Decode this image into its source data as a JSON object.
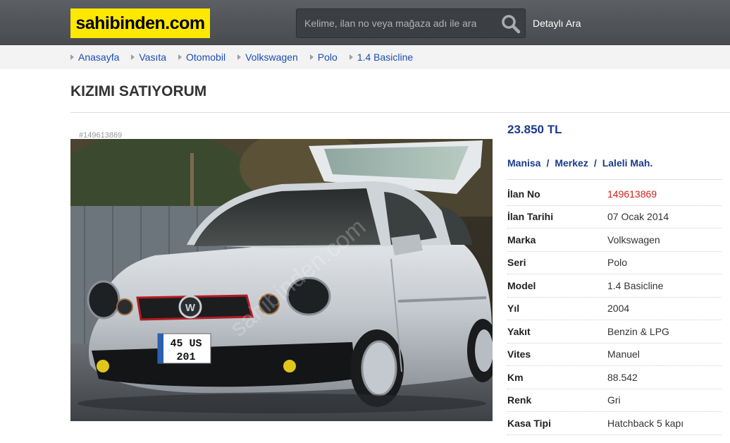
{
  "header": {
    "logo": "sahibinden.com",
    "search_placeholder": "Kelime, ilan no veya mağaza adı ile ara",
    "detailed_search": "Detaylı Ara"
  },
  "breadcrumb": [
    "Anasayfa",
    "Vasıta",
    "Otomobil",
    "Volkswagen",
    "Polo",
    "1.4 Basicline"
  ],
  "listing": {
    "title": "KIZIMI SATIYORUM",
    "photo_id": "#149613869",
    "watermark": "sahibinden.com",
    "plate_line1": "45  US",
    "plate_line2": "201",
    "price": "23.850 TL",
    "location": [
      "Manisa",
      "Merkez",
      "Laleli Mah."
    ],
    "location_sep": "/",
    "specs": [
      {
        "label": "İlan No",
        "value": "149613869"
      },
      {
        "label": "İlan Tarihi",
        "value": "07 Ocak 2014"
      },
      {
        "label": "Marka",
        "value": "Volkswagen"
      },
      {
        "label": "Seri",
        "value": "Polo"
      },
      {
        "label": "Model",
        "value": "1.4 Basicline"
      },
      {
        "label": "Yıl",
        "value": "2004"
      },
      {
        "label": "Yakıt",
        "value": "Benzin & LPG"
      },
      {
        "label": "Vites",
        "value": "Manuel"
      },
      {
        "label": "Km",
        "value": "88.542"
      },
      {
        "label": "Renk",
        "value": "Gri"
      },
      {
        "label": "Kasa Tipi",
        "value": "Hatchback 5 kapı"
      }
    ]
  },
  "colors": {
    "logo_bg": "#ffe800",
    "header_bg": "#4f5256",
    "link": "#1b4db3",
    "price": "#1b3a8c",
    "ad_no": "#d0211c"
  }
}
